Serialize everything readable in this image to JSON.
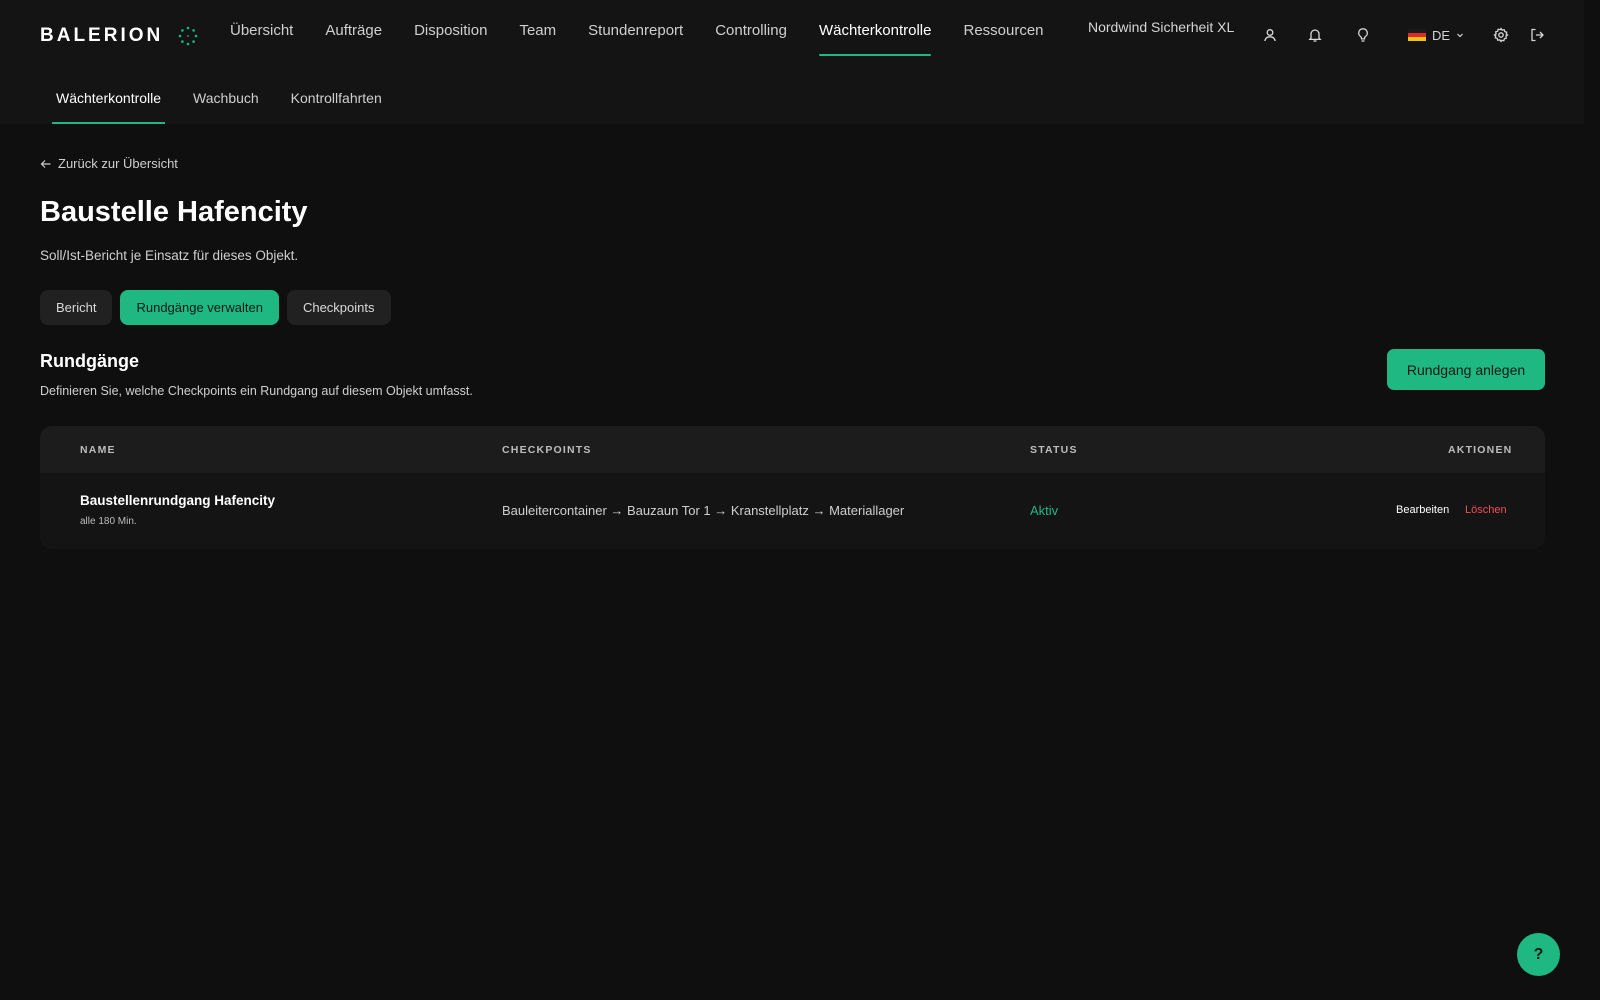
{
  "brand": {
    "name": "BALERION",
    "logo_icon": "sparkle-dots-icon"
  },
  "main_nav": [
    {
      "label": "Übersicht",
      "active": false
    },
    {
      "label": "Aufträge",
      "active": false
    },
    {
      "label": "Disposition",
      "active": false
    },
    {
      "label": "Team",
      "active": false
    },
    {
      "label": "Stundenreport",
      "active": false
    },
    {
      "label": "Controlling",
      "active": false
    },
    {
      "label": "Wächterkontrolle",
      "active": true
    },
    {
      "label": "Ressourcen",
      "active": false
    }
  ],
  "header": {
    "org_name": "Nordwind Sicherheit XL",
    "language": "DE",
    "icons": [
      "user-icon",
      "bell-icon",
      "lightbulb-icon",
      "germany-flag-icon",
      "chevron-down-icon",
      "gear-icon",
      "logout-icon"
    ]
  },
  "sub_nav": [
    {
      "label": "Wächterkontrolle",
      "active": true
    },
    {
      "label": "Wachbuch",
      "active": false
    },
    {
      "label": "Kontrollfahrten",
      "active": false
    }
  ],
  "page": {
    "back_link": "Zurück zur Übersicht",
    "title": "Baustelle Hafencity",
    "subtitle": "Soll/Ist-Bericht je Einsatz für dieses Objekt."
  },
  "tabs": [
    {
      "label": "Bericht",
      "active": false
    },
    {
      "label": "Rundgänge verwalten",
      "active": true
    },
    {
      "label": "Checkpoints",
      "active": false
    }
  ],
  "section": {
    "title": "Rundgänge",
    "description": "Definieren Sie, welche Checkpoints ein Rundgang auf diesem Objekt umfasst.",
    "create_button": "Rundgang anlegen"
  },
  "table": {
    "columns": {
      "name": "NAME",
      "checkpoints": "CHECKPOINTS",
      "status": "STATUS",
      "actions": "AKTIONEN"
    },
    "rows": [
      {
        "name": "Baustellenrundgang Hafencity",
        "interval": "alle 180 Min.",
        "checkpoints": "Bauleitercontainer → Bauzaun Tor 1 → Kranstellplatz → Materiallager",
        "status": "Aktiv",
        "edit_label": "Bearbeiten",
        "delete_label": "Löschen"
      }
    ]
  },
  "help": {
    "label": "?"
  },
  "colors": {
    "accent": "#1fb882",
    "background": "#0f0f0f",
    "danger": "#ef5050"
  }
}
